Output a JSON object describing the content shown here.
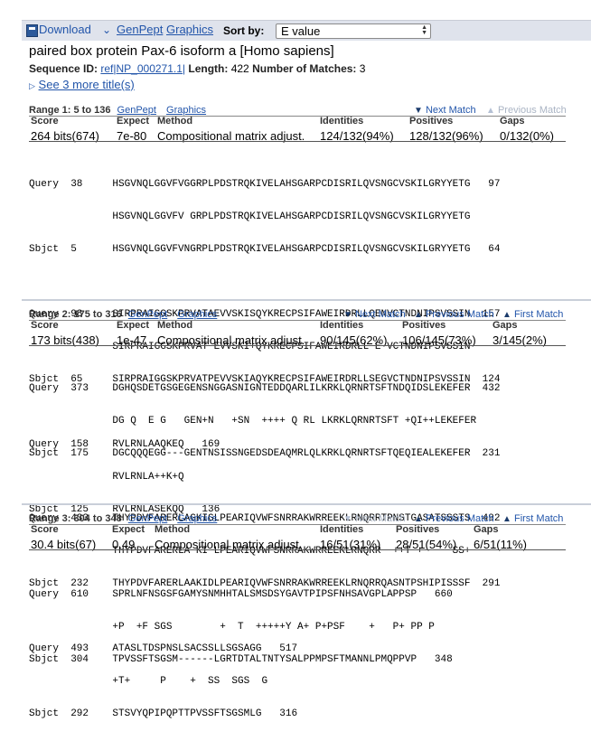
{
  "toolbar": {
    "download": "Download",
    "caret": "⌄",
    "genpept": "GenPept",
    "graphics": "Graphics",
    "sort_label": "Sort by:",
    "sort_value": "E value"
  },
  "hit": {
    "title": "paired box protein Pax-6 isoform a [Homo sapiens]",
    "seqid_label": "Sequence ID:",
    "seqid": "ref|NP_000271.1|",
    "length_label": "Length:",
    "length": "422",
    "matches_label": "Number of Matches:",
    "matches": "3",
    "more_titles": "See 3 more title(s)"
  },
  "score_headers": {
    "score": "Score",
    "expect": "Expect",
    "method": "Method",
    "identities": "Identities",
    "positives": "Positives",
    "gaps": "Gaps"
  },
  "nav_labels": {
    "next": "Next Match",
    "previous": "Previous Match",
    "first": "First Match"
  },
  "ranges": [
    {
      "label": "Range 1: 5 to 136",
      "genpept": "GenPept",
      "graphics": "Graphics",
      "score": "264 bits(674)",
      "expect": "7e-80",
      "method": "Compositional matrix adjust.",
      "identities": "124/132(94%)",
      "positives": "128/132(96%)",
      "gaps": "0/132(0%)",
      "alignment": [
        "Query  38     HSGVNQLGGVFVGGRPLPDSTRQKIVELAHSGARPCDISRILQVSNGCVSKILGRYYETG   97",
        "              HSGVNQLGGVFV GRPLPDSTRQKIVELAHSGARPCDISRILQVSNGCVSKILGRYYETG",
        "Sbjct  5      HSGVNQLGGVFVNGRPLPDSTRQKIVELAHSGARPCDISRILQVSNGCVSKILGRYYETG   64",
        "",
        "Query  98     SIRPRAIGGSKPRVATAEVVSKISQYKRECPSIFAWEIRDRLLQENVCTNDNIPSVSSIN  157",
        "              SIRPRAIGGSKPRVAT EVVSKI+QYKRECPSIFAWEIRDRLL E VCTNDNIPSVSSIN",
        "Sbjct  65     SIRPRAIGGSKPRVATPEVVSKIAQYKRECPSIFAWEIRDRLLSEGVCTNDNIPSVSSIN  124",
        "",
        "Query  158    RVLRNLAAQKEQ   169",
        "              RVLRNLA++K+Q",
        "Sbjct  125    RVLRNLASEKQQ   136"
      ]
    },
    {
      "label": "Range 2: 175 to 316",
      "genpept": "GenPept",
      "graphics": "Graphics",
      "score": "173 bits(438)",
      "expect": "1e-47",
      "method": "Compositional matrix adjust.",
      "identities": "90/145(62%)",
      "positives": "106/145(73%)",
      "gaps": "3/145(2%)",
      "alignment": [
        "Query  373    DGHQSDETGSGEGENSNGGASNIGNTEDDQARLILKRKLQRNRTSFTNDQIDSLEKEFER  432",
        "              DG Q  E G   GEN+N   +SN  ++++ Q RL LKRKLQRNRTSFT +QI++LEKEFER",
        "Sbjct  175    DGCQQQEGG---GENTNSISSNGEDSDEAQMRLQLKRKLQRNRTSFTQEQIEALEKEFER  231",
        "",
        "Query  433    THYPDVFARERLAGKIGLPEARIQVWFSNRRAKWRREEKLRNQRRTPNSTGASATSSSTS  492",
        "              THYPDVFARERLA KI LPEARIQVWFSNRRAKWRREEKLRNQRR  ++T +     SS+",
        "Sbjct  232    THYPDVFARERLAAKIDLPEARIQVWFSNRRAKWRREEKLRNQRRQASNTPSHIPISSSF  291",
        "",
        "Query  493    ATASLTDSPNSLSACSSLLSGSAGG   517",
        "              +T+     P    +  SS  SGS  G",
        "Sbjct  292    STSVYQPIPQPTTPVSSFTSGSMLG   316"
      ]
    },
    {
      "label": "Range 3: 304 to 348",
      "genpept": "GenPept",
      "graphics": "Graphics",
      "score": "30.4 bits(67)",
      "expect": "0.49",
      "method": "Compositional matrix adjust.",
      "identities": "16/51(31%)",
      "positives": "28/51(54%)",
      "gaps": "6/51(11%)",
      "alignment": [
        "Query  610    SPRLNFNSGSFGAMYSNMHHTALSMSDSYGAVTPIPSFNHSAVGPLAPPSP   660",
        "              +P  +F SGS        +  T  +++++Y A+ P+PSF    +   P+ PP P",
        "Sbjct  304    TPVSSFTSGSM------LGRTDTALTNTYSALPPMPSFTMANNLPMQPPVP   348"
      ]
    }
  ]
}
